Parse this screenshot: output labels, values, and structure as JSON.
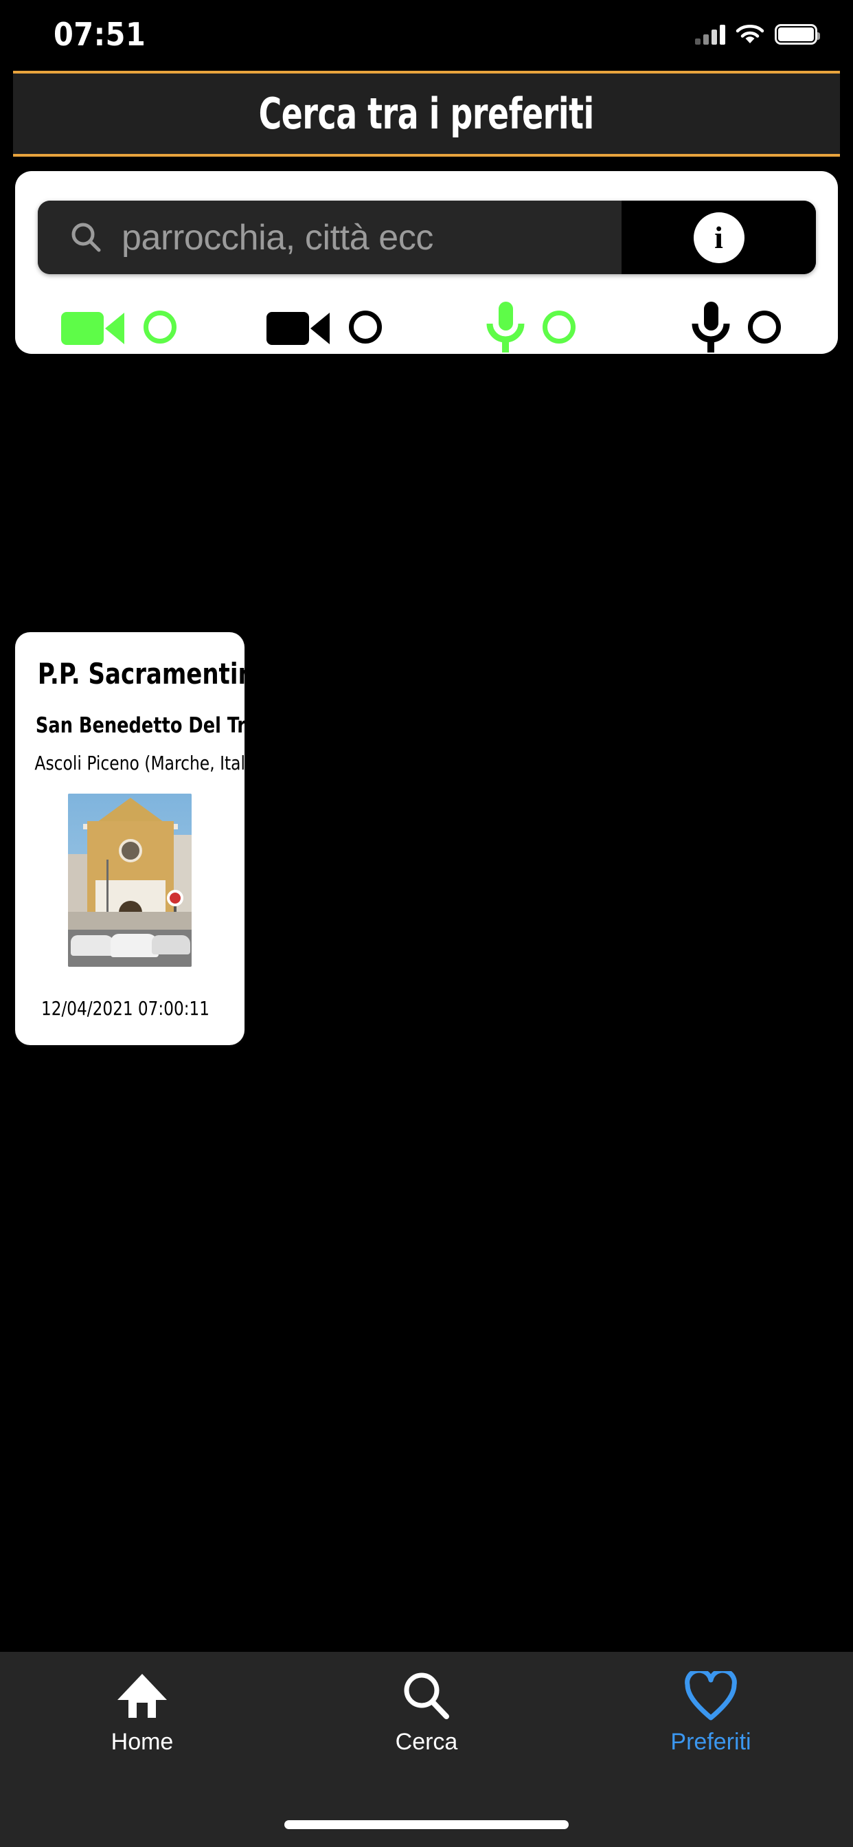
{
  "status_bar": {
    "time": "07:51",
    "signal_icon": "cellular-signal-icon",
    "wifi_icon": "wifi-icon",
    "battery_icon": "battery-icon"
  },
  "header": {
    "title": "Cerca tra i preferiti",
    "accent_color": "#e8a33d",
    "background_color": "#212121"
  },
  "search": {
    "placeholder": "parrocchia, città ecc",
    "value": "",
    "search_icon": "search-icon",
    "info_label": "i",
    "info_icon": "info-icon"
  },
  "filters": {
    "options": [
      {
        "icon": "video-camera-icon",
        "color": "#5efc48",
        "selected": false,
        "name": "video-live"
      },
      {
        "icon": "video-camera-icon",
        "color": "#000000",
        "selected": false,
        "name": "video-offline"
      },
      {
        "icon": "microphone-icon",
        "color": "#5efc48",
        "selected": false,
        "name": "audio-live"
      },
      {
        "icon": "microphone-icon",
        "color": "#000000",
        "selected": false,
        "name": "audio-offline"
      }
    ]
  },
  "results": [
    {
      "name": "P.P. Sacramentini",
      "city": "San Benedetto Del Tronto",
      "region": "Ascoli Piceno (Marche, Italia)",
      "media_icon": "video-camera-icon",
      "date": "12/04/2021 07:00:11",
      "favorite": true,
      "favorite_icon": "heart-filled-icon",
      "favorite_color": "#f5333f",
      "photo_alt": "church-facade-photo"
    }
  ],
  "tabbar": {
    "active": "Preferiti",
    "active_color": "#3b97f0",
    "items": [
      {
        "label": "Home",
        "icon": "home-icon"
      },
      {
        "label": "Cerca",
        "icon": "search-icon"
      },
      {
        "label": "Preferiti",
        "icon": "heart-outline-icon"
      }
    ]
  }
}
